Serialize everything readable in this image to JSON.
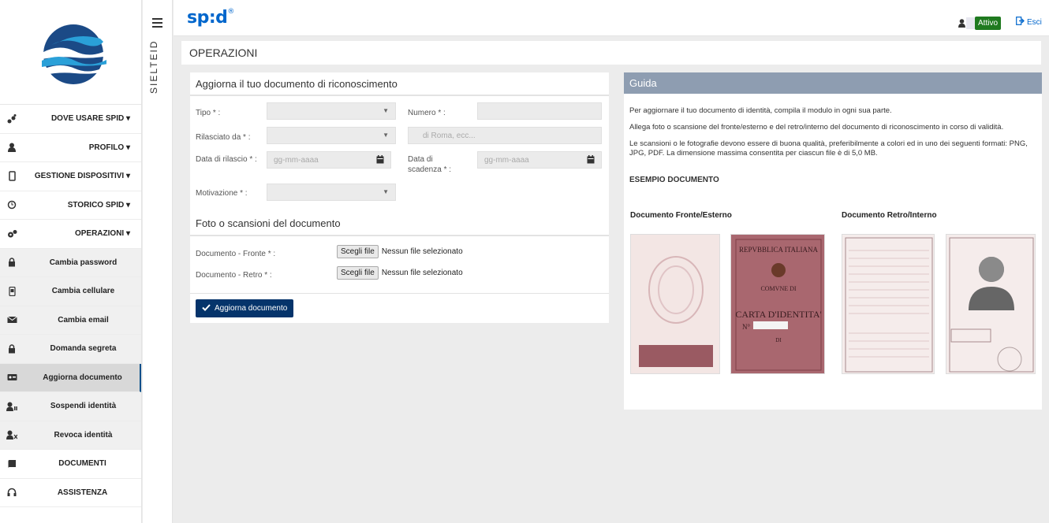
{
  "brand": {
    "name": "sp:d",
    "reg": "®"
  },
  "user_status": "Attivo",
  "logout_label": "Esci",
  "strip_label": "SIELTEID",
  "page_title": "OPERAZIONI",
  "menu": [
    {
      "label": "DOVE USARE SPID ▾",
      "icon": "dots-icon"
    },
    {
      "label": "PROFILO ▾",
      "icon": "user-icon"
    },
    {
      "label": "GESTIONE DISPOSITIVI ▾",
      "icon": "mobile-icon"
    },
    {
      "label": "STORICO SPID ▾",
      "icon": "history-icon"
    },
    {
      "label": "OPERAZIONI ▾",
      "icon": "gears-icon"
    },
    {
      "label": "Cambia password",
      "icon": "lock-icon"
    },
    {
      "label": "Cambia cellulare",
      "icon": "phone-icon"
    },
    {
      "label": "Cambia email",
      "icon": "mail-icon"
    },
    {
      "label": "Domanda segreta",
      "icon": "lock-icon"
    },
    {
      "label": "Aggiorna documento",
      "icon": "id-card-icon"
    },
    {
      "label": "Sospendi identità",
      "icon": "user-pause-icon"
    },
    {
      "label": "Revoca identità",
      "icon": "user-x-icon"
    },
    {
      "label": "DOCUMENTI",
      "icon": "book-icon"
    },
    {
      "label": "ASSISTENZA",
      "icon": "headset-icon"
    }
  ],
  "form": {
    "title": "Aggiorna il tuo documento di riconoscimento",
    "tipo_label": "Tipo * :",
    "numero_label": "Numero * :",
    "rilasciato_label": "Rilasciato da * :",
    "rilasciato_placeholder": "di Roma, ecc...",
    "data_rilascio_label": "Data di rilascio * :",
    "data_scadenza_label": "Data di scadenza * :",
    "date_placeholder": "gg-mm-aaaa",
    "motivazione_label": "Motivazione * :",
    "photo_title": "Foto o scansioni del documento",
    "fronte_label": "Documento - Fronte * :",
    "retro_label": "Documento - Retro * :",
    "file_button": "Scegli file",
    "file_status": "Nessun file selezionato",
    "submit_label": "Aggiorna documento"
  },
  "guide": {
    "title": "Guida",
    "p1": "Per aggiornare il tuo documento di identità, compila il modulo in ogni sua parte.",
    "p2": "Allega foto o scansione del fronte/esterno e del retro/interno del documento di riconoscimento in corso di validità.",
    "p3": "Le scansioni o le fotografie devono essere di buona qualità, preferibilmente a colori ed in uno dei seguenti formati: PNG, JPG, PDF. La dimensione massima consentita per ciascun file è di 5,0 MB.",
    "example_title": "ESEMPIO DOCUMENTO",
    "front_caption": "Documento Fronte/Esterno",
    "back_caption": "Documento Retro/Interno",
    "card_header": "REPVBBLICA ITALIANA",
    "card_comune": "COMVNE DI",
    "card_title": "CARTA D'IDENTITA'",
    "card_no": "N°",
    "card_di": "DI"
  },
  "colors": {
    "accent": "#0066cc",
    "submit": "#05346b",
    "guide_header": "#8e9db1",
    "active_badge": "#1f7a1f"
  }
}
